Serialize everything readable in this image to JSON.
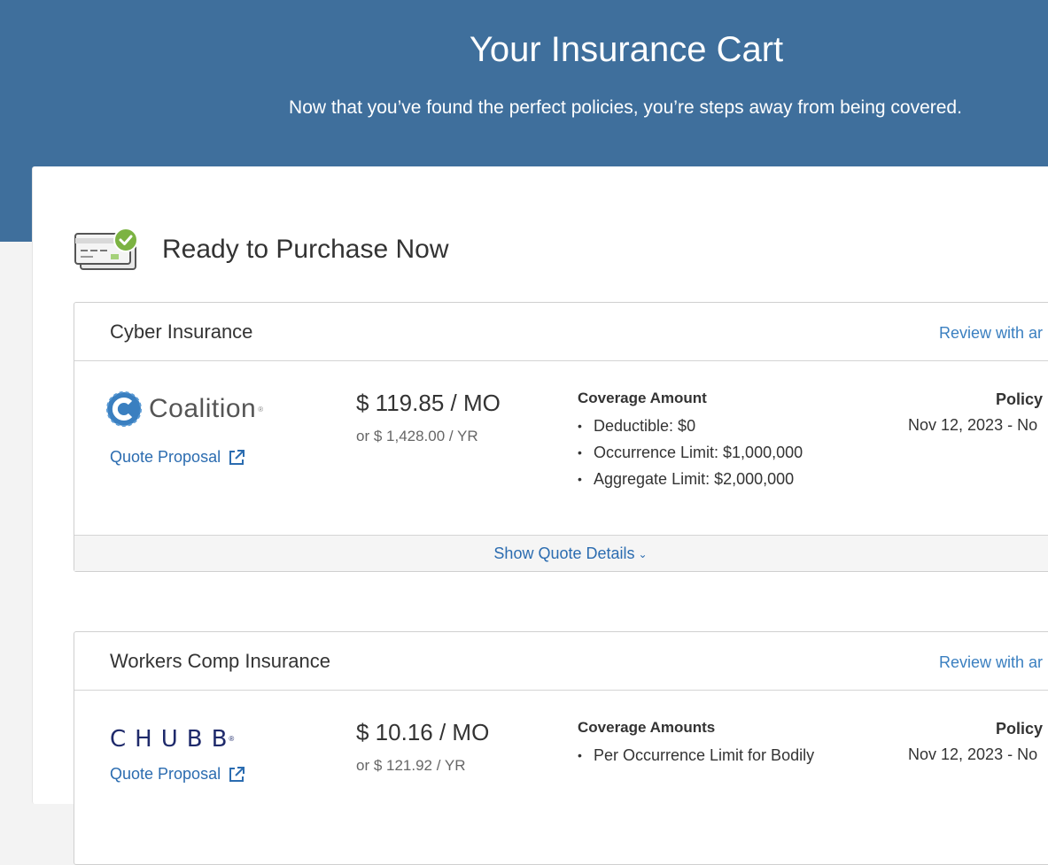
{
  "hero": {
    "title": "Your Insurance Cart",
    "subtitle": "Now that you’ve found the perfect policies, you’re steps away from being covered."
  },
  "section": {
    "title": "Ready to Purchase Now",
    "icon": "credit-card-check-icon"
  },
  "colors": {
    "header_bg": "#3f6f9c",
    "link": "#2b6cb0",
    "check_green": "#7cb342",
    "chubb_navy": "#1f2a6b"
  },
  "cards": [
    {
      "type": "Cyber Insurance",
      "review_label": "Review with ar",
      "carrier": "Coalition",
      "quote_link": "Quote Proposal",
      "price_monthly": "$ 119.85 / MO",
      "price_yearly": "or $ 1,428.00 / YR",
      "coverage_title": "Coverage Amount",
      "coverage_items": [
        "Deductible: $0",
        "Occurrence Limit: $1,000,000",
        "Aggregate Limit: $2,000,000"
      ],
      "policy_label": "Policy",
      "policy_dates": "Nov 12, 2023 - No",
      "details_link": "Show Quote Details"
    },
    {
      "type": "Workers Comp Insurance",
      "review_label": "Review with ar",
      "carrier": "CHUBB",
      "quote_link": "Quote Proposal",
      "price_monthly": "$ 10.16 / MO",
      "price_yearly": "or $ 121.92 / YR",
      "coverage_title": "Coverage Amounts",
      "coverage_items": [
        "Per Occurrence Limit for Bodily"
      ],
      "policy_label": "Policy",
      "policy_dates": "Nov 12, 2023 - No"
    }
  ]
}
